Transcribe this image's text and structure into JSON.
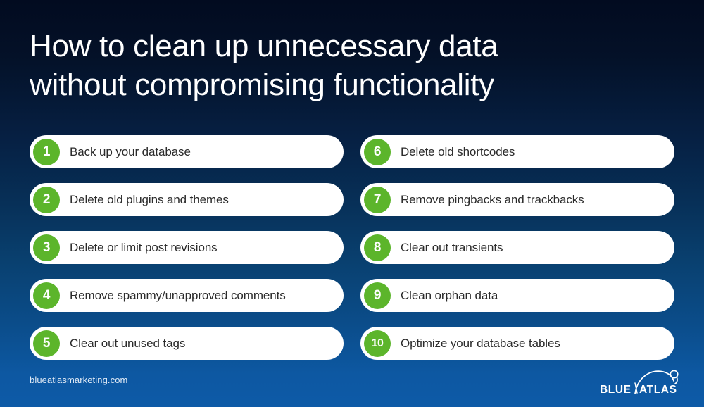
{
  "title": {
    "line1": "How to clean up unnecessary data",
    "line2": "without compromising functionality"
  },
  "colors": {
    "background_top": "#020b20",
    "background_bottom": "#0d5aa7",
    "badge_green": "#5cb52b",
    "pill_white": "#ffffff",
    "pill_text": "#2b2b2b",
    "title_text": "#ffffff",
    "footer_text": "#dfe9f5"
  },
  "left_column": [
    {
      "number": "1",
      "label": "Back up your database"
    },
    {
      "number": "2",
      "label": "Delete old plugins and themes"
    },
    {
      "number": "3",
      "label": "Delete or limit post revisions"
    },
    {
      "number": "4",
      "label": "Remove spammy/unapproved comments"
    },
    {
      "number": "5",
      "label": "Clear out unused tags"
    }
  ],
  "right_column": [
    {
      "number": "6",
      "label": "Delete old shortcodes"
    },
    {
      "number": "7",
      "label": "Remove pingbacks and trackbacks"
    },
    {
      "number": "8",
      "label": "Clear out transients"
    },
    {
      "number": "9",
      "label": "Clean orphan data"
    },
    {
      "number": "10",
      "label": "Optimize your database tables"
    }
  ],
  "footer": {
    "url": "blueatlasmarketing.com",
    "logo_word1": "BLUE",
    "logo_word2": "ATLAS"
  }
}
